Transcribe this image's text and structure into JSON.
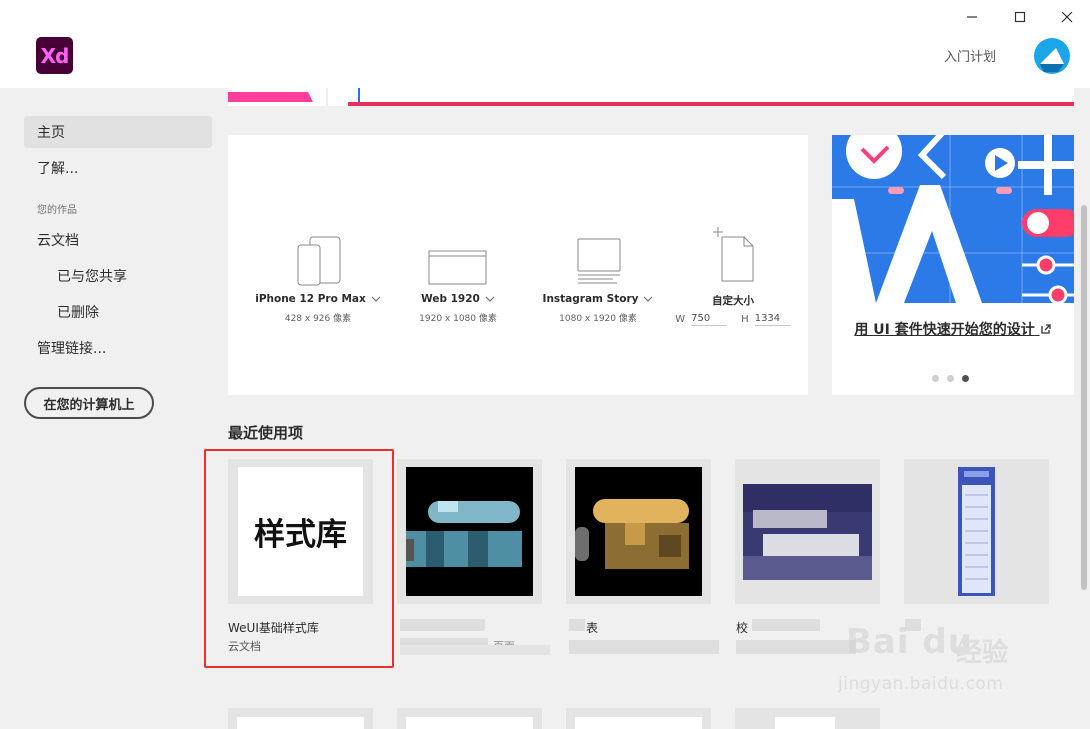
{
  "app": {
    "logo_text": "Xd"
  },
  "header": {
    "learn_link": "入门计划"
  },
  "sidebar": {
    "items": [
      {
        "label": "主页"
      },
      {
        "label": "了解..."
      },
      {
        "label": "云文档"
      },
      {
        "label": "已与您共享"
      },
      {
        "label": "已删除"
      },
      {
        "label": "管理链接..."
      }
    ],
    "section_label": "您的作品",
    "local_button": "在您的计算机上"
  },
  "presets": [
    {
      "name": "iPhone 12 Pro Max",
      "dims": "428 x 926 像素",
      "icon": "phone-icon"
    },
    {
      "name": "Web 1920",
      "dims": "1920 x 1080 像素",
      "icon": "browser-icon"
    },
    {
      "name": "Instagram Story",
      "dims": "1080 x 1920 像素",
      "icon": "instagram-story-icon"
    },
    {
      "name": "自定大小",
      "icon": "custom-size-icon",
      "w_label": "W",
      "w_value": "750",
      "h_label": "H",
      "h_value": "1334"
    }
  ],
  "promo": {
    "link_text": "用 UI 套件快速开始您的设计",
    "dots_count": 3,
    "active_dot": 3
  },
  "recent": {
    "title": "最近使用项",
    "items": [
      {
        "thumb_text": "样式库",
        "title": "WeUI基础样式库",
        "subtitle": "云文档"
      },
      {
        "title": "",
        "subtitle": "",
        "extra": "页面"
      },
      {
        "title": "表",
        "subtitle": ""
      },
      {
        "title": "校",
        "subtitle": ""
      },
      {
        "title": "",
        "subtitle": ""
      }
    ]
  },
  "watermark": {
    "brand": "Bai du",
    "sub": "经验",
    "url": "jingyan.baidu.com"
  },
  "colors": {
    "accent_red": "#e8302c",
    "xd_purple": "#470137",
    "xd_pink": "#ff61f6",
    "promo_blue": "#2c7ae8"
  }
}
